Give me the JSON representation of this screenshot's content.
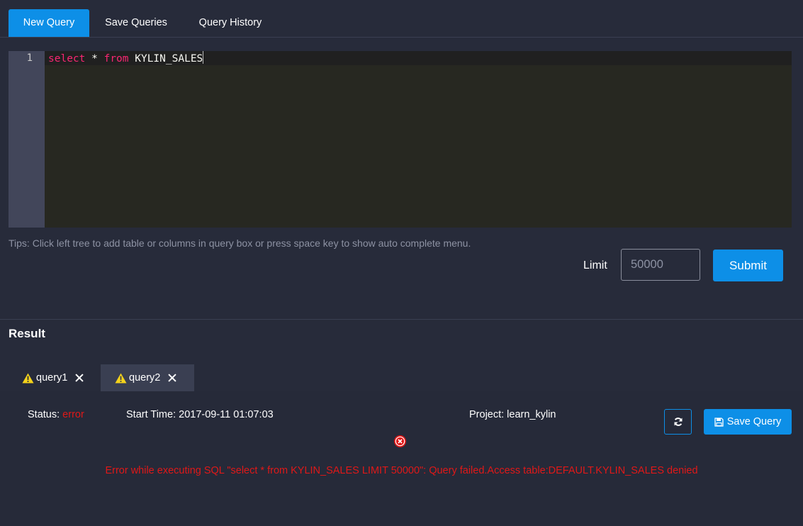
{
  "tabs": {
    "new_query": "New Query",
    "save_queries": "Save Queries",
    "query_history": "Query History"
  },
  "editor": {
    "line_number": "1",
    "keyword_select": "select",
    "star": " * ",
    "keyword_from": "from",
    "table": " KYLIN_SALES"
  },
  "tips": "Tips: Click left tree to add table or columns in query box or press space key to show auto complete menu.",
  "limit": {
    "label": "Limit",
    "placeholder": "50000"
  },
  "submit_label": "Submit",
  "result": {
    "title": "Result",
    "tabs": [
      {
        "label": "query1",
        "icon": "warning-icon"
      },
      {
        "label": "query2",
        "icon": "warning-icon"
      }
    ],
    "status_label": "Status: ",
    "status_value": "error",
    "start_time": "Start Time: 2017-09-11 01:07:03",
    "project": "Project: learn_kylin",
    "save_query_label": "Save Query",
    "error_message": "Error while executing SQL \"select * from KYLIN_SALES LIMIT 50000\": Query failed.Access table:DEFAULT.KYLIN_SALES denied"
  },
  "colors": {
    "accent": "#0d8fe7",
    "error": "#e01818",
    "warning": "#f5d31b",
    "background": "#272b3a"
  }
}
